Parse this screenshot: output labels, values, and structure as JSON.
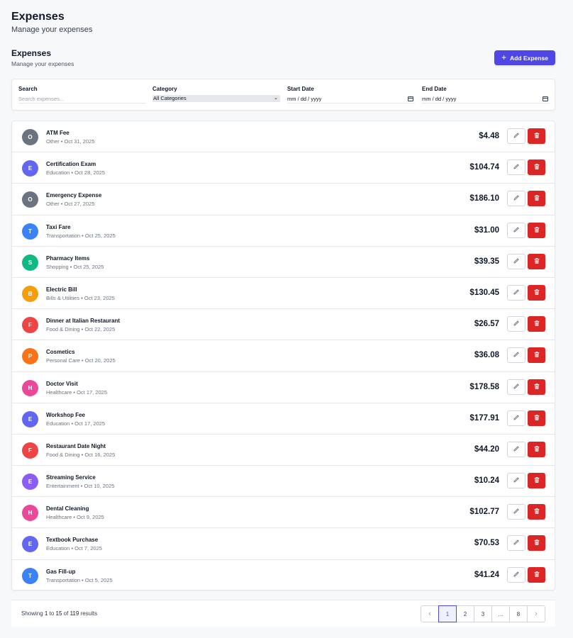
{
  "page": {
    "title": "Expenses",
    "subtitle": "Manage your expenses"
  },
  "section": {
    "title": "Expenses",
    "subtitle": "Manage your expenses",
    "add_label": "Add Expense"
  },
  "filters": {
    "search": {
      "label": "Search",
      "placeholder": "Search expenses..."
    },
    "category": {
      "label": "Category",
      "value": "All Categories"
    },
    "start_date": {
      "label": "Start Date",
      "value": "mm / dd / yyyy"
    },
    "end_date": {
      "label": "End Date",
      "value": "mm / dd / yyyy"
    }
  },
  "expenses": [
    {
      "initial": "O",
      "color": "#6b7280",
      "title": "ATM Fee",
      "meta": "Other • Oct 31, 2025",
      "amount": "$4.48"
    },
    {
      "initial": "E",
      "color": "#6366f1",
      "title": "Certification Exam",
      "meta": "Education • Oct 28, 2025",
      "amount": "$104.74"
    },
    {
      "initial": "O",
      "color": "#6b7280",
      "title": "Emergency Expense",
      "meta": "Other • Oct 27, 2025",
      "amount": "$186.10"
    },
    {
      "initial": "T",
      "color": "#3b82f6",
      "title": "Taxi Fare",
      "meta": "Transportation • Oct 25, 2025",
      "amount": "$31.00"
    },
    {
      "initial": "S",
      "color": "#10b981",
      "title": "Pharmacy Items",
      "meta": "Shopping • Oct 25, 2025",
      "amount": "$39.35"
    },
    {
      "initial": "B",
      "color": "#f59e0b",
      "title": "Electric Bill",
      "meta": "Bills & Utilities • Oct 23, 2025",
      "amount": "$130.45"
    },
    {
      "initial": "F",
      "color": "#ef4444",
      "title": "Dinner at Italian Restaurant",
      "meta": "Food & Dining • Oct 22, 2025",
      "amount": "$26.57"
    },
    {
      "initial": "P",
      "color": "#f97316",
      "title": "Cosmetics",
      "meta": "Personal Care • Oct 20, 2025",
      "amount": "$36.08"
    },
    {
      "initial": "H",
      "color": "#ec4899",
      "title": "Doctor Visit",
      "meta": "Healthcare • Oct 17, 2025",
      "amount": "$178.58"
    },
    {
      "initial": "E",
      "color": "#6366f1",
      "title": "Workshop Fee",
      "meta": "Education • Oct 17, 2025",
      "amount": "$177.91"
    },
    {
      "initial": "F",
      "color": "#ef4444",
      "title": "Restaurant Date Night",
      "meta": "Food & Dining • Oct 16, 2025",
      "amount": "$44.20"
    },
    {
      "initial": "E",
      "color": "#8b5cf6",
      "title": "Streaming Service",
      "meta": "Entertainment • Oct 10, 2025",
      "amount": "$10.24"
    },
    {
      "initial": "H",
      "color": "#ec4899",
      "title": "Dental Cleaning",
      "meta": "Healthcare • Oct 9, 2025",
      "amount": "$102.77"
    },
    {
      "initial": "E",
      "color": "#6366f1",
      "title": "Textbook Purchase",
      "meta": "Education • Oct 7, 2025",
      "amount": "$70.53"
    },
    {
      "initial": "T",
      "color": "#3b82f6",
      "title": "Gas Fill-up",
      "meta": "Transportation • Oct 5, 2025",
      "amount": "$41.24"
    }
  ],
  "pagination": {
    "showing_prefix": "Showing",
    "from": "1",
    "to_word": "to",
    "to": "15",
    "of_word": "of",
    "total": "119",
    "results_word": "results",
    "pages": [
      "1",
      "2",
      "3",
      "...",
      "8"
    ],
    "current": "1"
  },
  "icons": {
    "add": "plus-icon",
    "edit": "pencil-icon",
    "delete": "trash-icon",
    "calendar": "calendar-icon",
    "prev": "chevron-left-icon",
    "next": "chevron-right-icon"
  },
  "colors": {
    "accent": "#4f46e5",
    "danger": "#dc2626"
  }
}
